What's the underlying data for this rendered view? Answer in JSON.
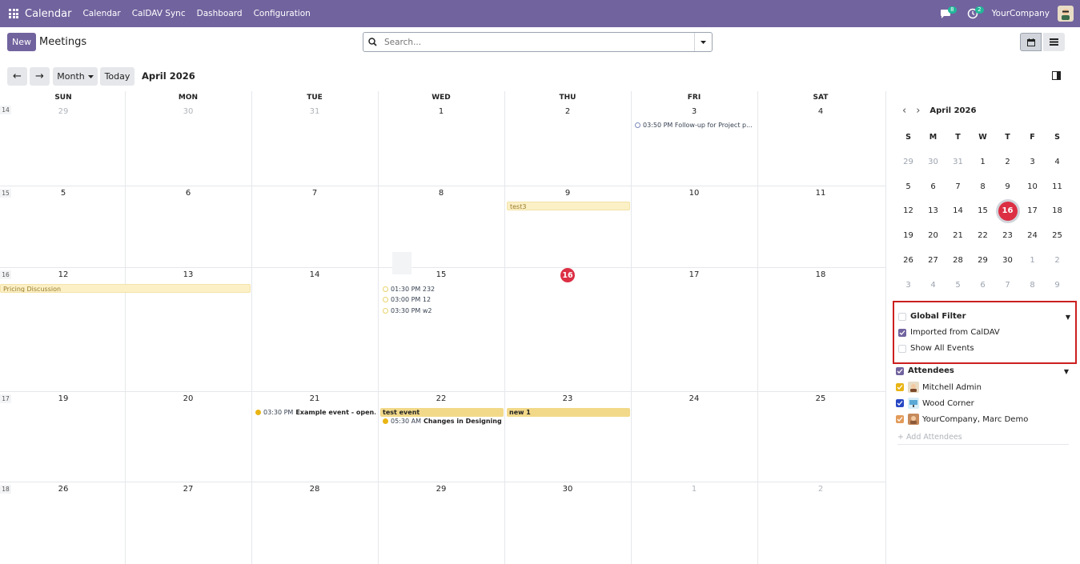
{
  "navbar": {
    "brand": "Calendar",
    "menu": [
      "Calendar",
      "CalDAV Sync",
      "Dashboard",
      "Configuration"
    ],
    "chat_badge": "8",
    "activity_badge": "2",
    "company": "YourCompany",
    "icons": [
      "apps-grid-icon",
      "chat-icon",
      "activity-clock-icon",
      "user-avatar"
    ]
  },
  "control": {
    "new_label": "New",
    "title": "Meetings",
    "search_placeholder": "Search...",
    "month_label": "Month",
    "today_label": "Today",
    "period": "April 2026",
    "prev_symbol": "←",
    "next_symbol": "→"
  },
  "calendar": {
    "weekdays": [
      "SUN",
      "MON",
      "TUE",
      "WED",
      "THU",
      "FRI",
      "SAT"
    ],
    "weeks": [
      {
        "num": "14",
        "days": [
          {
            "d": "29",
            "m": true
          },
          {
            "d": "30",
            "m": true
          },
          {
            "d": "31",
            "m": true
          },
          {
            "d": "1"
          },
          {
            "d": "2"
          },
          {
            "d": "3"
          },
          {
            "d": "4"
          }
        ]
      },
      {
        "num": "15",
        "days": [
          {
            "d": "5"
          },
          {
            "d": "6"
          },
          {
            "d": "7"
          },
          {
            "d": "8"
          },
          {
            "d": "9"
          },
          {
            "d": "10"
          },
          {
            "d": "11"
          }
        ]
      },
      {
        "num": "16",
        "days": [
          {
            "d": "12"
          },
          {
            "d": "13"
          },
          {
            "d": "14"
          },
          {
            "d": "15"
          },
          {
            "d": "16",
            "today": true
          },
          {
            "d": "17"
          },
          {
            "d": "18"
          }
        ]
      },
      {
        "num": "17",
        "days": [
          {
            "d": "19"
          },
          {
            "d": "20"
          },
          {
            "d": "21"
          },
          {
            "d": "22"
          },
          {
            "d": "23"
          },
          {
            "d": "24"
          },
          {
            "d": "25"
          }
        ]
      },
      {
        "num": "18",
        "days": [
          {
            "d": "26"
          },
          {
            "d": "27"
          },
          {
            "d": "28"
          },
          {
            "d": "29"
          },
          {
            "d": "30"
          },
          {
            "d": "1",
            "m": true
          },
          {
            "d": "2",
            "m": true
          }
        ]
      }
    ],
    "events": {
      "followup": {
        "time": "03:50 PM",
        "title": "Follow-up for Project p..."
      },
      "test3": "test3",
      "pricing": "Pricing Discussion",
      "wed15": [
        {
          "time": "01:30 PM",
          "title": "232"
        },
        {
          "time": "03:00 PM",
          "title": "12"
        },
        {
          "time": "03:30 PM",
          "title": "w2"
        }
      ],
      "example": {
        "time": "03:30 PM",
        "title": "Example event - open..."
      },
      "test_event": "test event",
      "designing": {
        "time": "05:30 AM",
        "title": "Changes in Designing"
      },
      "new1": "new 1"
    }
  },
  "sidebar": {
    "mini_title": "April 2026",
    "mini_weekdays": [
      "S",
      "M",
      "T",
      "W",
      "T",
      "F",
      "S"
    ],
    "mini_weeks": [
      [
        {
          "d": "29",
          "m": true
        },
        {
          "d": "30",
          "m": true
        },
        {
          "d": "31",
          "m": true
        },
        {
          "d": "1"
        },
        {
          "d": "2"
        },
        {
          "d": "3"
        },
        {
          "d": "4"
        }
      ],
      [
        {
          "d": "5"
        },
        {
          "d": "6"
        },
        {
          "d": "7"
        },
        {
          "d": "8"
        },
        {
          "d": "9"
        },
        {
          "d": "10"
        },
        {
          "d": "11"
        }
      ],
      [
        {
          "d": "12"
        },
        {
          "d": "13"
        },
        {
          "d": "14"
        },
        {
          "d": "15"
        },
        {
          "d": "16",
          "today": true
        },
        {
          "d": "17"
        },
        {
          "d": "18"
        }
      ],
      [
        {
          "d": "19"
        },
        {
          "d": "20"
        },
        {
          "d": "21"
        },
        {
          "d": "22"
        },
        {
          "d": "23"
        },
        {
          "d": "24"
        },
        {
          "d": "25"
        }
      ],
      [
        {
          "d": "26"
        },
        {
          "d": "27"
        },
        {
          "d": "28"
        },
        {
          "d": "29"
        },
        {
          "d": "30"
        },
        {
          "d": "1",
          "m": true
        },
        {
          "d": "2",
          "m": true
        }
      ],
      [
        {
          "d": "3",
          "m": true
        },
        {
          "d": "4",
          "m": true
        },
        {
          "d": "5",
          "m": true
        },
        {
          "d": "6",
          "m": true
        },
        {
          "d": "7",
          "m": true
        },
        {
          "d": "8",
          "m": true
        },
        {
          "d": "9",
          "m": true
        }
      ]
    ],
    "global_filter": {
      "title": "Global Filter",
      "items": [
        {
          "label": "Imported from CalDAV",
          "checked": true
        },
        {
          "label": "Show All Events",
          "checked": false
        }
      ]
    },
    "attendees": {
      "title": "Attendees",
      "items": [
        {
          "label": "Mitchell Admin",
          "color": "#e9b514"
        },
        {
          "label": "Wood Corner",
          "color": "#2747c4"
        },
        {
          "label": "YourCompany, Marc Demo",
          "color": "#e39b5a"
        }
      ],
      "add_placeholder": "+ Add Attendees"
    }
  },
  "colors": {
    "brand": "#71639e",
    "today": "#dc2f44",
    "highlight_border": "#cc1f1f"
  }
}
